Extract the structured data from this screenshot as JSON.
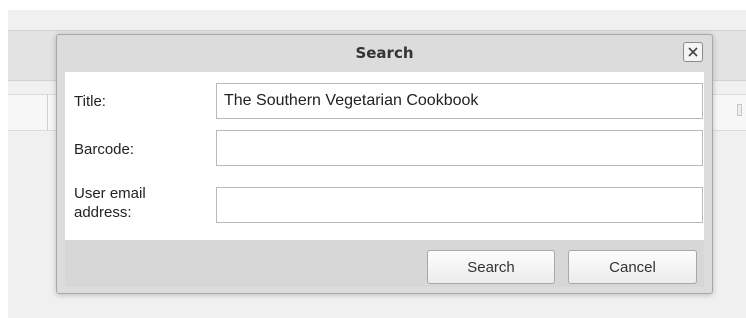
{
  "dialog": {
    "title": "Search",
    "close_glyph": "close-icon"
  },
  "form": {
    "title_label": "Title:",
    "title_value": "The Southern Vegetarian Cookbook",
    "barcode_label": "Barcode:",
    "barcode_value": "",
    "email_label_line1": "User email",
    "email_label_line2": "address:",
    "email_value": ""
  },
  "buttons": {
    "search_label": "Search",
    "cancel_label": "Cancel"
  }
}
